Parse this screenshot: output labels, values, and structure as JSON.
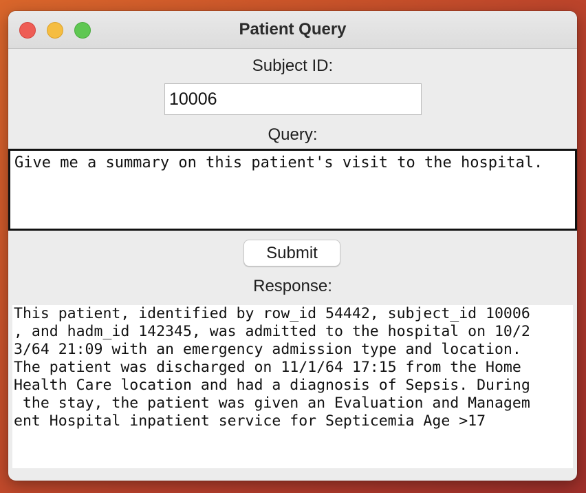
{
  "window": {
    "title": "Patient Query"
  },
  "subject": {
    "label": "Subject ID:",
    "value": "10006"
  },
  "query": {
    "label": "Query:",
    "value": "Give me a summary on this patient's visit to the hospital."
  },
  "submit": {
    "label": "Submit"
  },
  "response": {
    "label": "Response:",
    "lines": [
      "This patient, identified by row_id 54442, subject_id 10006",
      ", and hadm_id 142345, was admitted to the hospital on 10/2",
      "3/64 21:09 with an emergency admission type and location.",
      "The patient was discharged on 11/1/64 17:15 from the Home",
      "Health Care location and had a diagnosis of Sepsis. During",
      " the stay, the patient was given an Evaluation and Managem",
      "ent Hospital inpatient service for Septicemia Age >17"
    ]
  },
  "colors": {
    "close": "#ee5d55",
    "minimize": "#f5bd41",
    "maximize": "#5fc752"
  }
}
